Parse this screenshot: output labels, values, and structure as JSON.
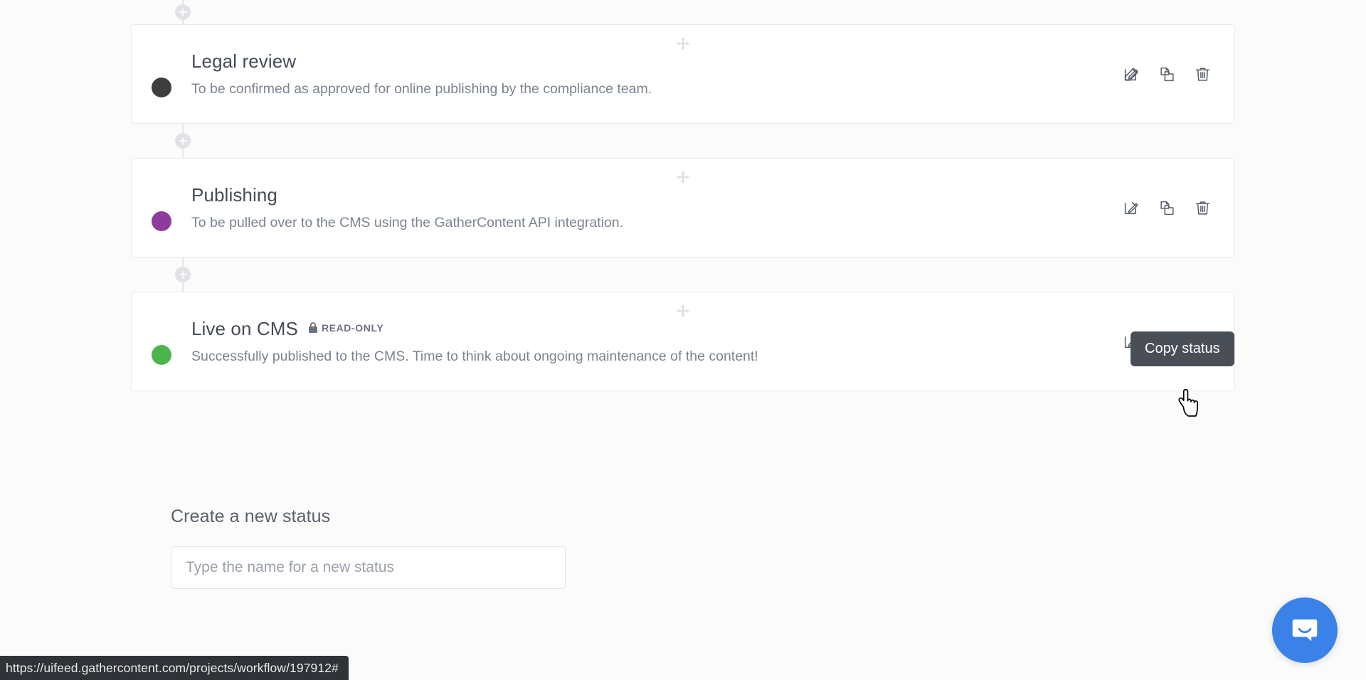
{
  "page": {
    "background_color": "#fbfbfc"
  },
  "workflow": {
    "statuses": [
      {
        "name": "Legal review",
        "description": "To be confirmed as approved for online publishing by the compliance team.",
        "color": "#3e3e3e",
        "read_only": false,
        "read_only_label": ""
      },
      {
        "name": "Publishing",
        "description": "To be pulled over to the CMS using the GatherContent API integration.",
        "color": "#8e3c9b",
        "read_only": false,
        "read_only_label": ""
      },
      {
        "name": "Live on CMS",
        "description": "Successfully published to the CMS. Time to think about ongoing maintenance of the content!",
        "color": "#4cb64c",
        "read_only": true,
        "read_only_label": "READ-ONLY"
      }
    ],
    "actions": {
      "edit_label": "Edit status",
      "copy_label": "Copy status",
      "delete_label": "Delete status"
    },
    "add_between_label": "Add a status here",
    "drag_handle_label": "Drag to reorder"
  },
  "tooltip": {
    "text": "Copy status",
    "background_color": "#4a4f57",
    "text_color": "#ffffff"
  },
  "create_status": {
    "heading": "Create a new status",
    "input_value": "",
    "input_placeholder": "Type the name for a new status"
  },
  "intercom": {
    "label": "Open Intercom Messenger",
    "color": "#3b82e8"
  },
  "status_bar": {
    "url": "https://uifeed.gathercontent.com/projects/workflow/197912#"
  },
  "cursor": {
    "type": "pointer-hand"
  }
}
